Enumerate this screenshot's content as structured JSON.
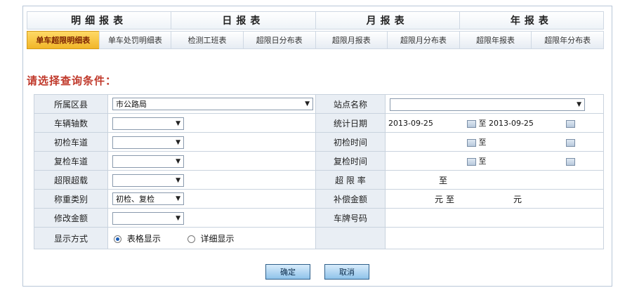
{
  "groups": [
    "明细报表",
    "日报表",
    "月报表",
    "年报表"
  ],
  "tabs": [
    "单车超限明细表",
    "单车处罚明细表",
    "检测工班表",
    "超限日分布表",
    "超限月报表",
    "超限月分布表",
    "超限年报表",
    "超限年分布表"
  ],
  "active_tab": "单车超限明细表",
  "prompt": "请选择查询条件：",
  "left": {
    "county_label": "所属区县",
    "county_value": "市公路局",
    "axles_label": "车辆轴数",
    "first_lane_label": "初检车道",
    "recheck_lane_label": "复检车道",
    "overload_label": "超限超载",
    "weigh_type_label": "称重类别",
    "weigh_type_value": "初检、复检",
    "modify_amount_label": "修改金额",
    "display_label": "显示方式",
    "display_table": "表格显示",
    "display_detail": "详细显示"
  },
  "right": {
    "station_label": "站点名称",
    "date_label": "统计日期",
    "date_from": "2013-09-25",
    "date_to": "2013-09-25",
    "to_text": "至",
    "first_time_label": "初检时间",
    "recheck_time_label": "复检时间",
    "overload_rate_label": "超 限 率",
    "comp_label": "补偿金额",
    "yuan": "元",
    "plate_label": "车牌号码"
  },
  "buttons": {
    "ok": "确定",
    "cancel": "取消"
  }
}
